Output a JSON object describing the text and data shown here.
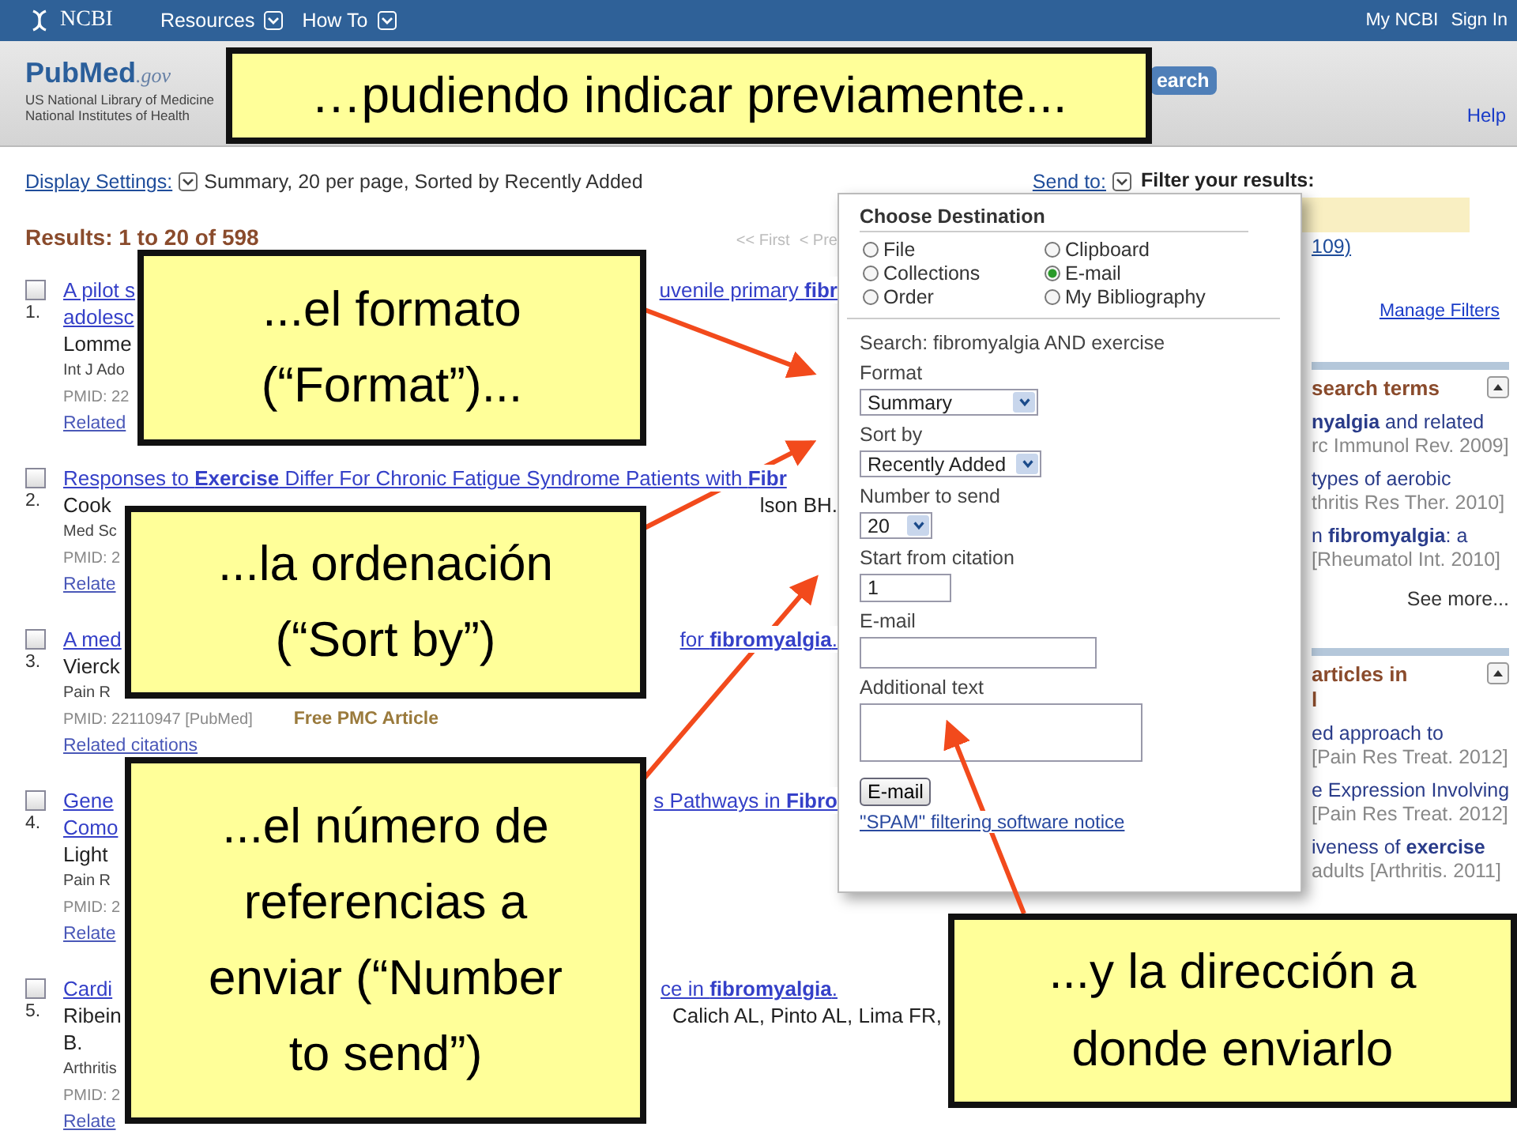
{
  "header": {
    "logo": "NCBI",
    "menus": [
      {
        "label": "Resources"
      },
      {
        "label": "How To"
      }
    ],
    "links": [
      "My NCBI",
      "Sign In"
    ]
  },
  "banner": {
    "logo": "PubMed",
    "logo_suffix": ".gov",
    "org_lines": [
      "US National Library of Medicine",
      "National Institutes of Health"
    ],
    "search_button": "earch",
    "help": "Help"
  },
  "display_bar": {
    "settings_link": "Display Settings:",
    "summary": "Summary, 20 per page, Sorted by Recently Added",
    "send_to": "Send to:"
  },
  "results": {
    "heading": "Results: 1 to 20 of 598",
    "pager": [
      "<< First",
      "< Pre"
    ],
    "items": [
      {
        "number": "1.",
        "checked": false,
        "lines": [
          {
            "kind": "title",
            "left": "A pilot s",
            "right": "uvenile primary **fibr**"
          },
          {
            "kind": "title",
            "left": "adolesc"
          },
          {
            "kind": "text",
            "left": "Lomme"
          },
          {
            "kind": "journal",
            "left": "Int J Ado"
          },
          {
            "kind": "meta",
            "left": "PMID: 22"
          },
          {
            "kind": "link",
            "left": "Related"
          }
        ]
      },
      {
        "number": "2.",
        "checked": false,
        "lines": [
          {
            "kind": "title",
            "left": "Responses to **Exercise** Differ For Chronic Fatigue Syndrome Patients with **Fibr**"
          },
          {
            "kind": "text",
            "left": "Cook",
            "right": "lson BH."
          },
          {
            "kind": "journal",
            "left": "Med Sc"
          },
          {
            "kind": "meta",
            "left": "PMID: 2"
          },
          {
            "kind": "link",
            "left": "Relate"
          }
        ]
      },
      {
        "number": "3.",
        "checked": false,
        "lines": [
          {
            "kind": "title",
            "left": "A med",
            "right": "for **fibromyalgia**."
          },
          {
            "kind": "text",
            "left": "Vierck"
          },
          {
            "kind": "journal",
            "left": "Pain R"
          },
          {
            "kind": "meta",
            "left": "PMID: 22110947 [PubMed]",
            "badge": "Free PMC Article"
          },
          {
            "kind": "link",
            "left": "Related citations"
          }
        ]
      },
      {
        "number": "4.",
        "checked": false,
        "lines": [
          {
            "kind": "title",
            "left": "Gene",
            "right": "s Pathways in **Fibro**"
          },
          {
            "kind": "title",
            "left": "Como"
          },
          {
            "kind": "text",
            "left": "Light"
          },
          {
            "kind": "journal",
            "left": "Pain R"
          },
          {
            "kind": "meta",
            "left": "PMID: 2"
          },
          {
            "kind": "link",
            "left": "Relate"
          }
        ]
      },
      {
        "number": "5.",
        "checked": false,
        "lines": [
          {
            "kind": "title",
            "left": "Cardi",
            "right": "ce in **fibromyalgia**."
          },
          {
            "kind": "text",
            "left": "Ribein",
            "right": "Calich AL, Pinto AL, Lima FR,"
          },
          {
            "kind": "text",
            "left": "B."
          },
          {
            "kind": "journal",
            "left": "Arthritis"
          },
          {
            "kind": "meta",
            "left": "PMID: 2"
          },
          {
            "kind": "link",
            "left": "Relate"
          }
        ]
      }
    ]
  },
  "sidebar": {
    "filter_title": "Filter your results:",
    "filter_count": "109)",
    "manage": "Manage Filters",
    "sections": [
      {
        "title": "search terms",
        "entries": [
          {
            "title": "**nyalgia** and related",
            "source": "rc Immunol Rev. 2009]"
          },
          {
            "title": "types of aerobic",
            "source": "thritis Res Ther. 2010]"
          },
          {
            "title": "n **fibromyalgia**: a",
            "source": "[Rheumatol Int. 2010]"
          }
        ],
        "more": "See more..."
      },
      {
        "title": "articles in\nl",
        "entries": [
          {
            "title": "ed approach to",
            "source": "[Pain Res Treat. 2012]"
          },
          {
            "title": "e Expression Involving",
            "source": "[Pain Res Treat. 2012]"
          },
          {
            "title": "iveness of **exercise**",
            "source": "adults [Arthritis. 2011]"
          }
        ]
      }
    ]
  },
  "popup": {
    "title": "Choose Destination",
    "destinations": [
      {
        "label": "File",
        "selected": false
      },
      {
        "label": "Clipboard",
        "selected": false
      },
      {
        "label": "Collections",
        "selected": false
      },
      {
        "label": "E-mail",
        "selected": true
      },
      {
        "label": "Order",
        "selected": false
      },
      {
        "label": "My Bibliography",
        "selected": false
      }
    ],
    "search": "Search: fibromyalgia AND exercise",
    "fields": [
      {
        "kind": "select",
        "label": "Format",
        "value": "Summary"
      },
      {
        "kind": "select",
        "label": "Sort by",
        "value": "Recently Added"
      },
      {
        "kind": "select",
        "label": "Number to send",
        "value": "20"
      },
      {
        "kind": "input",
        "label": "Start from citation",
        "value": "1"
      },
      {
        "kind": "input",
        "label": "E-mail"
      },
      {
        "kind": "textarea",
        "label": "Additional text"
      }
    ],
    "button": "E-mail",
    "notice": "\"SPAM\" filtering software notice"
  },
  "callouts": [
    {
      "text": "…pudiendo indicar previamente..."
    },
    {
      "text": "...el formato\n(“Format”)..."
    },
    {
      "text": "...la ordenación\n(“Sort by”)"
    },
    {
      "text": "...el número de\nreferencias a\nenviar (“Number\nto send”)"
    },
    {
      "text": "...y la dirección a\ndonde enviarlo"
    }
  ]
}
